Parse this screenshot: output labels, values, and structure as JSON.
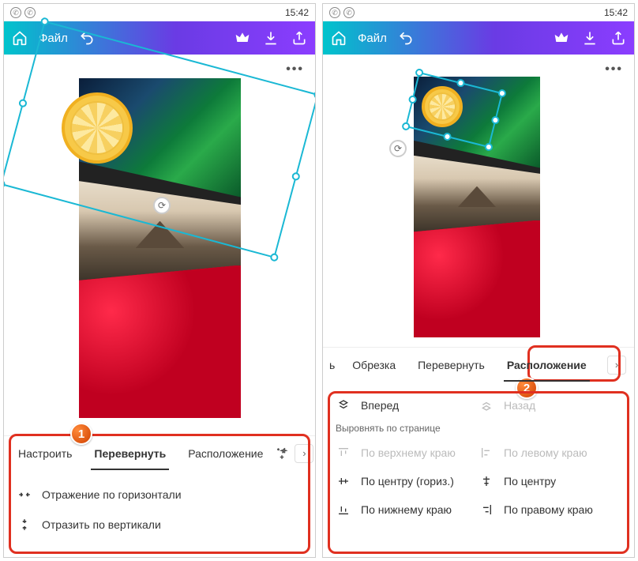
{
  "status": {
    "time": "15:42"
  },
  "topbar": {
    "file_label": "Файл"
  },
  "left": {
    "tabs": {
      "adjust": "Настроить",
      "flip": "Перевернуть",
      "position": "Расположение"
    },
    "options": {
      "flip_h": "Отражение по горизонтали",
      "flip_v": "Отразить по вертикали"
    },
    "badge": "1"
  },
  "right": {
    "tabs": {
      "cut_partial": "ь",
      "crop": "Обрезка",
      "flip": "Перевернуть",
      "position": "Расположение"
    },
    "layer": {
      "forward": "Вперед",
      "backward": "Назад"
    },
    "align_section": "Выровнять по странице",
    "align": {
      "top": "По верхнему краю",
      "center_h": "По центру (гориз.)",
      "bottom": "По нижнему краю",
      "left": "По левому краю",
      "center": "По центру",
      "right": "По правому краю"
    },
    "badge": "2"
  }
}
